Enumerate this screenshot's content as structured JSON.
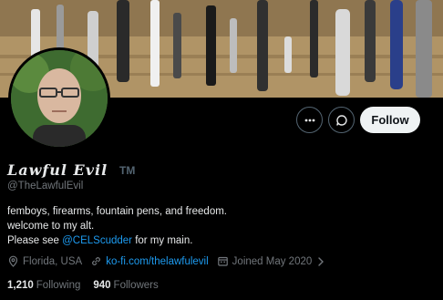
{
  "profile": {
    "display_name": "Lawful Evil",
    "trademark": "TM",
    "handle": "@TheLawfulEvil",
    "bio": {
      "line1": "femboys, firearms, fountain pens, and freedom.",
      "line2": "welcome to my alt.",
      "line3_prefix": "Please see ",
      "line3_mention": "@CELScudder",
      "line3_suffix": " for my main."
    },
    "location": "Florida, USA",
    "website": "ko-fi.com/thelawfulevil",
    "joined": "Joined May 2020",
    "following_count": "1,210",
    "following_label": "Following",
    "followers_count": "940",
    "followers_label": "Followers"
  },
  "actions": {
    "follow_label": "Follow"
  },
  "icons": {
    "more": "more-icon",
    "message": "message-icon",
    "location": "location-icon",
    "link": "link-icon",
    "calendar": "calendar-icon",
    "chevron": "chevron-right-icon"
  },
  "colors": {
    "accent": "#1d9bf0",
    "background": "#000000",
    "text": "#e7e9ea",
    "muted": "#71767b",
    "follow_button_bg": "#eff3f4"
  }
}
